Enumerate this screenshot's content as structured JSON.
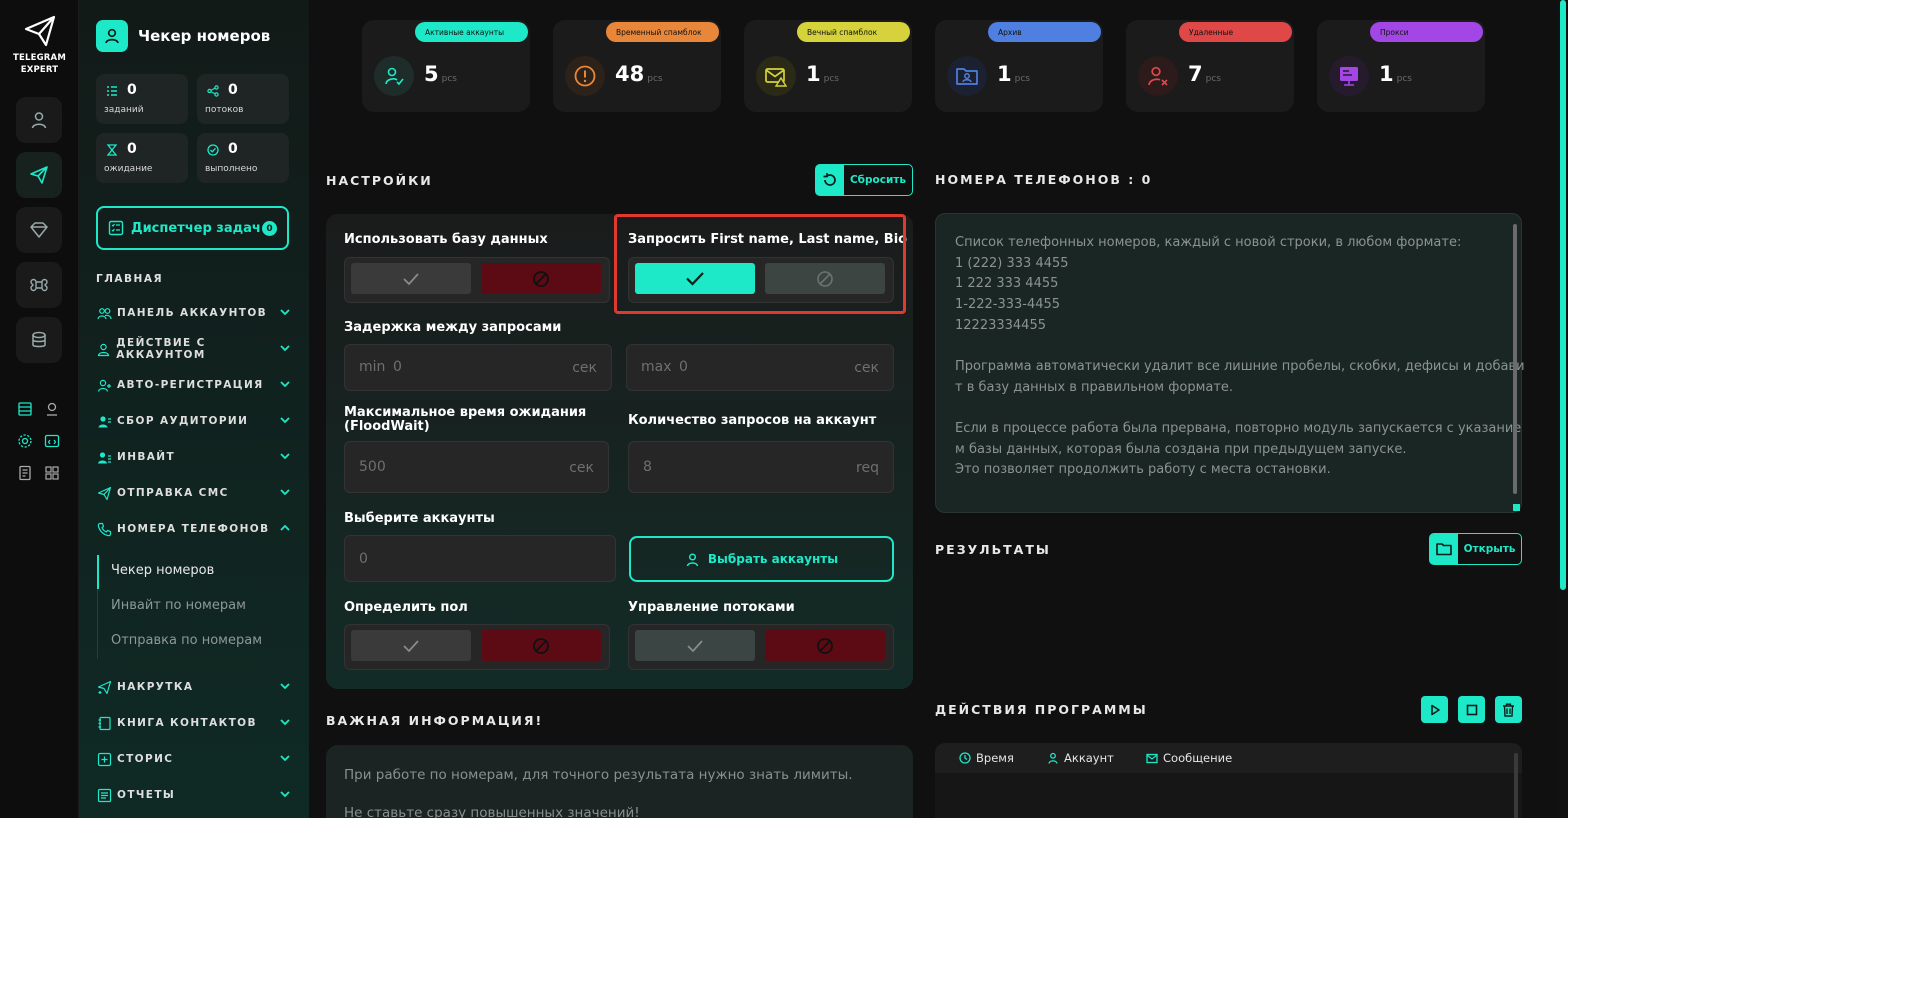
{
  "app": {
    "logo_line1": "TELEGRAM",
    "logo_line2": "EXPERT"
  },
  "sidebar": {
    "title": "Чекер номеров",
    "stats": [
      {
        "value": "0",
        "label": "заданий"
      },
      {
        "value": "0",
        "label": "потоков"
      },
      {
        "value": "0",
        "label": "ожидание"
      },
      {
        "value": "0",
        "label": "выполнено"
      }
    ],
    "dispatcher": {
      "label": "Диспетчер задач",
      "count": "0"
    },
    "section": "ГЛАВНАЯ",
    "nav": [
      {
        "label": "ПАНЕЛЬ АККАУНТОВ"
      },
      {
        "label": "ДЕЙСТВИЕ С АККАУНТОМ"
      },
      {
        "label": "АВТО-РЕГИСТРАЦИЯ"
      },
      {
        "label": "СБОР АУДИТОРИИ"
      },
      {
        "label": "ИНВАЙТ"
      },
      {
        "label": "ОТПРАВКА СМС"
      },
      {
        "label": "НОМЕРА ТЕЛЕФОНОВ"
      },
      {
        "label": "НАКРУТКА"
      },
      {
        "label": "КНИГА КОНТАКТОВ"
      },
      {
        "label": "СТОРИС"
      },
      {
        "label": "ОТЧЕТЫ"
      }
    ],
    "sub": [
      "Чекер номеров",
      "Инвайт по номерам",
      "Отправка по номерам"
    ]
  },
  "cards": [
    {
      "label": "Активные аккаунты",
      "value": "5",
      "unit": "pcs",
      "color": "#1de9c9"
    },
    {
      "label": "Временный спамблок",
      "value": "48",
      "unit": "pcs",
      "color": "#e8873a"
    },
    {
      "label": "Вечный спамблок",
      "value": "1",
      "unit": "pcs",
      "color": "#d6d23b"
    },
    {
      "label": "Архив",
      "value": "1",
      "unit": "pcs",
      "color": "#4f7fe0"
    },
    {
      "label": "Удаленные",
      "value": "7",
      "unit": "pcs",
      "color": "#e04848"
    },
    {
      "label": "Прокси",
      "value": "1",
      "unit": "pcs",
      "color": "#a247e6"
    }
  ],
  "settings": {
    "heading": "НАСТРОЙКИ",
    "reset": "Сбросить",
    "use_db": "Использовать базу данных",
    "request_names": "Запросить First name, Last name, Bio",
    "delay": "Задержка между запросами",
    "min_prefix": "min",
    "min_value": "0",
    "max_prefix": "max",
    "max_value": "0",
    "sec": "сек",
    "floodwait_line1": "Максимальное время ожидания",
    "floodwait_line2": "(FloodWait)",
    "floodwait_value": "500",
    "req_per_acc": "Количество запросов на аккаунт",
    "req_value": "8",
    "req_unit": "req",
    "choose_accounts": "Выберите аккаунты",
    "accounts_value": "0",
    "select_accounts_btn": "Выбрать аккаунты",
    "gender": "Определить пол",
    "threads": "Управление потоками"
  },
  "info": {
    "heading": "ВАЖНАЯ ИНФОРМАЦИЯ!",
    "line1": "При работе по номерам, для точного результата нужно знать лимиты.",
    "line2": "Не ставьте сразу повышенных значений!"
  },
  "phones": {
    "heading": "НОМЕРА ТЕЛЕФОНОВ : 0",
    "lines": [
      "Список телефонных номеров, каждый с новой строки, в любом формате:",
      "1 (222) 333 4455",
      "1 222 333 4455",
      "1-222-333-4455",
      "12223334455",
      "",
      " Программа автоматически удалит все лишние пробелы, скобки, дефисы и добави",
      "т в базу данных в правильном формате.",
      "",
      "Если в процессе работа была прервана, повторно модуль запускается с указание",
      "м базы данных, которая была создана при предыдущем запуске.",
      "Это позволяет продолжить работу с места остановки."
    ]
  },
  "results": {
    "heading": "РЕЗУЛЬТАТЫ",
    "open": "Открыть"
  },
  "actions": {
    "heading": "ДЕЙСТВИЯ ПРОГРАММЫ",
    "col_time": "Время",
    "col_account": "Аккаунт",
    "col_message": "Сообщение"
  }
}
